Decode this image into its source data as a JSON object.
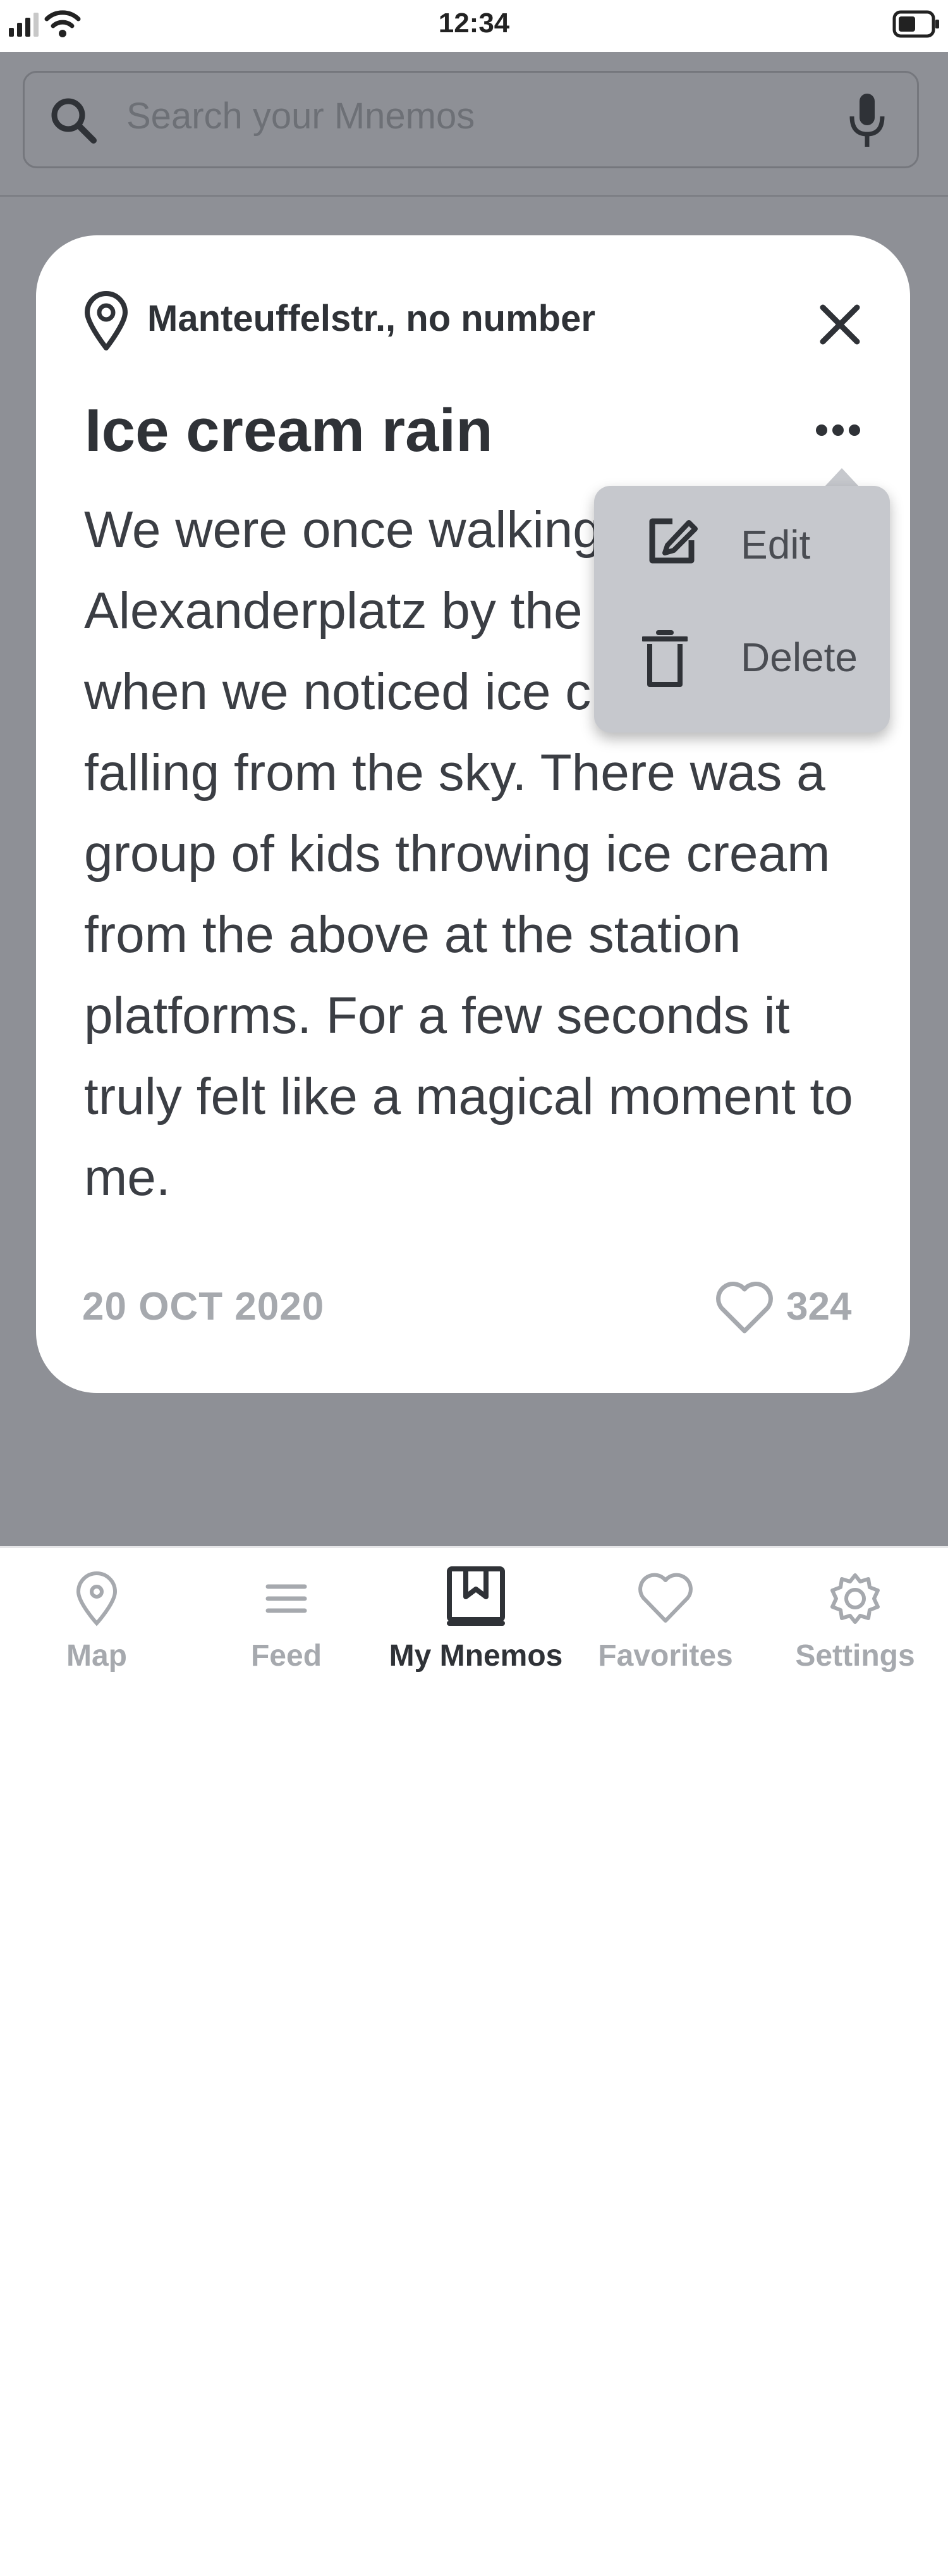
{
  "status_bar": {
    "time": "12:34"
  },
  "search": {
    "placeholder": "Search your Mnemos"
  },
  "card": {
    "location": "Manteuffelstr., no number",
    "title": "Ice cream rain",
    "body": "We were once walking across Alexanderplatz by the train station when we noticed ice cream balls falling from the sky. There was a group of kids throwing ice cream from the above at the station platforms. For a few seconds it truly felt like a magical moment to me.",
    "date": "20 OCT 2020",
    "likes": "324"
  },
  "menu": {
    "edit_label": "Edit",
    "delete_label": "Delete"
  },
  "tabs": [
    {
      "label": "Map",
      "icon": "map-pin-icon",
      "active": false
    },
    {
      "label": "Feed",
      "icon": "list-icon",
      "active": false
    },
    {
      "label": "My Mnemos",
      "icon": "book-icon",
      "active": true
    },
    {
      "label": "Favorites",
      "icon": "heart-icon",
      "active": false
    },
    {
      "label": "Settings",
      "icon": "gear-icon",
      "active": false
    }
  ],
  "colors": {
    "overlay": "#8e9096",
    "active_tab": "#2f3237",
    "inactive_tab": "#a6a9ae",
    "menu_bg": "#c6c8cd"
  }
}
